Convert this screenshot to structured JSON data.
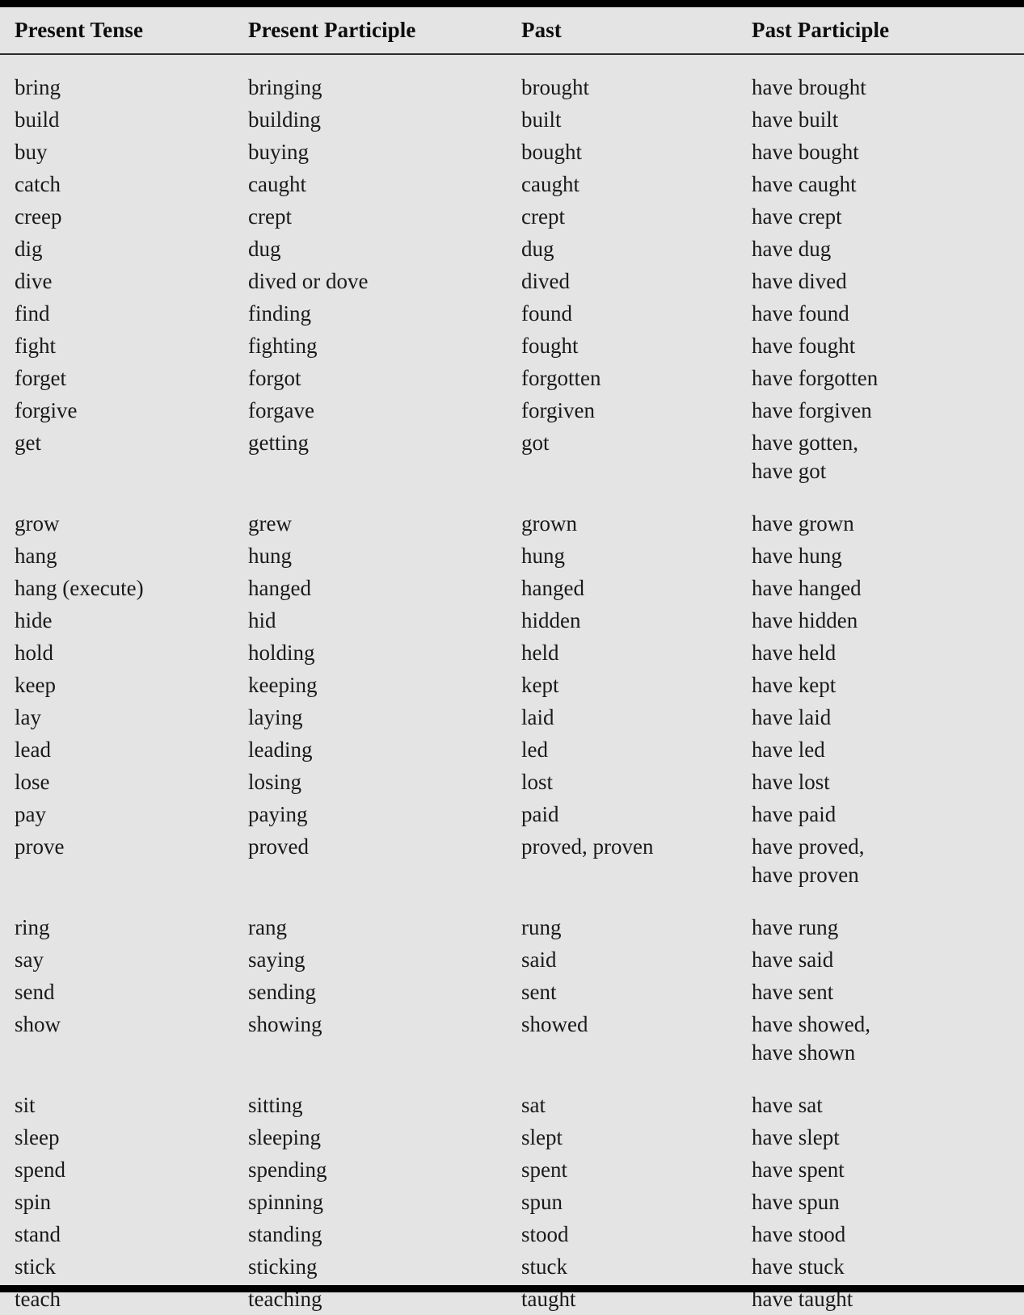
{
  "table": {
    "headers": [
      "Present Tense",
      "Present Participle",
      "Past",
      "Past Participle"
    ],
    "rows": [
      {
        "present": "bring",
        "participle": "bringing",
        "past": "brought",
        "past_participle": "have brought",
        "past_participle_line2": ""
      },
      {
        "present": "build",
        "participle": "building",
        "past": "built",
        "past_participle": "have built",
        "past_participle_line2": ""
      },
      {
        "present": "buy",
        "participle": "buying",
        "past": "bought",
        "past_participle": "have bought",
        "past_participle_line2": ""
      },
      {
        "present": "catch",
        "participle": "caught",
        "past": "caught",
        "past_participle": "have caught",
        "past_participle_line2": ""
      },
      {
        "present": "creep",
        "participle": "crept",
        "past": "crept",
        "past_participle": "have crept",
        "past_participle_line2": ""
      },
      {
        "present": "dig",
        "participle": "dug",
        "past": "dug",
        "past_participle": "have dug",
        "past_participle_line2": ""
      },
      {
        "present": "dive",
        "participle": "dived or dove",
        "past": "dived",
        "past_participle": "have dived",
        "past_participle_line2": ""
      },
      {
        "present": "find",
        "participle": "finding",
        "past": "found",
        "past_participle": "have found",
        "past_participle_line2": ""
      },
      {
        "present": "fight",
        "participle": "fighting",
        "past": "fought",
        "past_participle": "have fought",
        "past_participle_line2": ""
      },
      {
        "present": "forget",
        "participle": "forgot",
        "past": "forgotten",
        "past_participle": "have forgotten",
        "past_participle_line2": ""
      },
      {
        "present": "forgive",
        "participle": "forgave",
        "past": "forgiven",
        "past_participle": "have forgiven",
        "past_participle_line2": ""
      },
      {
        "present": "get",
        "participle": "getting",
        "past": "got",
        "past_participle": "have gotten,",
        "past_participle_line2": "have got"
      },
      {
        "present": "grow",
        "participle": "grew",
        "past": "grown",
        "past_participle": "have grown",
        "past_participle_line2": ""
      },
      {
        "present": "hang",
        "participle": "hung",
        "past": "hung",
        "past_participle": "have hung",
        "past_participle_line2": ""
      },
      {
        "present": "hang (execute)",
        "participle": "hanged",
        "past": "hanged",
        "past_participle": "have hanged",
        "past_participle_line2": ""
      },
      {
        "present": "hide",
        "participle": "hid",
        "past": "hidden",
        "past_participle": "have hidden",
        "past_participle_line2": ""
      },
      {
        "present": "hold",
        "participle": "holding",
        "past": "held",
        "past_participle": "have held",
        "past_participle_line2": ""
      },
      {
        "present": "keep",
        "participle": "keeping",
        "past": "kept",
        "past_participle": "have kept",
        "past_participle_line2": ""
      },
      {
        "present": "lay",
        "participle": "laying",
        "past": "laid",
        "past_participle": "have laid",
        "past_participle_line2": ""
      },
      {
        "present": "lead",
        "participle": "leading",
        "past": "led",
        "past_participle": "have led",
        "past_participle_line2": ""
      },
      {
        "present": "lose",
        "participle": "losing",
        "past": "lost",
        "past_participle": "have lost",
        "past_participle_line2": ""
      },
      {
        "present": "pay",
        "participle": "paying",
        "past": "paid",
        "past_participle": "have paid",
        "past_participle_line2": ""
      },
      {
        "present": "prove",
        "participle": "proved",
        "past": "proved, proven",
        "past_participle": "have proved,",
        "past_participle_line2": "have proven"
      },
      {
        "present": "ring",
        "participle": "rang",
        "past": "rung",
        "past_participle": "have rung",
        "past_participle_line2": ""
      },
      {
        "present": "say",
        "participle": "saying",
        "past": "said",
        "past_participle": "have said",
        "past_participle_line2": ""
      },
      {
        "present": "send",
        "participle": "sending",
        "past": "sent",
        "past_participle": "have sent",
        "past_participle_line2": ""
      },
      {
        "present": "show",
        "participle": "showing",
        "past": "showed",
        "past_participle": "have showed,",
        "past_participle_line2": "have shown"
      },
      {
        "present": "sit",
        "participle": "sitting",
        "past": "sat",
        "past_participle": "have sat",
        "past_participle_line2": ""
      },
      {
        "present": "sleep",
        "participle": "sleeping",
        "past": "slept",
        "past_participle": "have slept",
        "past_participle_line2": ""
      },
      {
        "present": "spend",
        "participle": "spending",
        "past": "spent",
        "past_participle": "have spent",
        "past_participle_line2": ""
      },
      {
        "present": "spin",
        "participle": "spinning",
        "past": "spun",
        "past_participle": "have spun",
        "past_participle_line2": ""
      },
      {
        "present": "stand",
        "participle": "standing",
        "past": "stood",
        "past_participle": "have stood",
        "past_participle_line2": ""
      },
      {
        "present": "stick",
        "participle": "sticking",
        "past": "stuck",
        "past_participle": "have stuck",
        "past_participle_line2": ""
      },
      {
        "present": "teach",
        "participle": "teaching",
        "past": "taught",
        "past_participle": "have taught",
        "past_participle_line2": ""
      }
    ]
  },
  "style": {
    "background_color": "#e4e4e4",
    "text_color": "#1a1a1a",
    "rule_color": "#000000"
  }
}
